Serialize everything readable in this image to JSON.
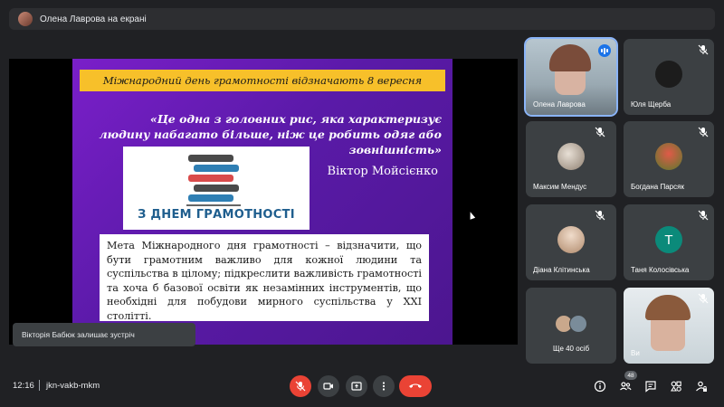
{
  "presenter": {
    "label": "Олена Лаврова на екрані"
  },
  "slide": {
    "header": "Міжнародний день грамотності відзначають  8 вересня",
    "quote": "«Це одна з головних рис, яка характеризує людину набагато більше, ніж це робить одяг  або зовнішність»",
    "author": "Віктор Мойсієнко",
    "book_caption": "З ДНЕМ ГРАМОТНОСТІ",
    "body": "Мета Міжнародного дня грамотності – відзначити, що бути грамотним важливо для кожної людини та суспільства в цілому; підкреслити важливість грамотності та хоча б базової освіти як незамінних інструментів, що необхідні для побудови мирного суспільства у XXI столітті."
  },
  "toast": "Вікторія Бабюк залишає зустріч",
  "tiles": [
    {
      "name": "Олена Лаврова",
      "avatar_color": "#d9b8a8"
    },
    {
      "name": "Юля Щерба",
      "avatar_color": "#1c1c1c"
    },
    {
      "name": "Максим Мендус",
      "avatar_color": "#c8bfb4"
    },
    {
      "name": "Богдана Парсяк",
      "avatar_color": "#c84a3a"
    },
    {
      "name": "Діана Клітинська",
      "avatar_color": "#e6d2c0"
    },
    {
      "name": "Таня Колосівська",
      "initial": "Т",
      "avatar_color": "#0b8a7a"
    },
    {
      "name": "Ще 40 осіб"
    },
    {
      "name": "Ви",
      "avatar_color": "#cdd8de"
    }
  ],
  "bottom": {
    "time": "12:16",
    "meeting_code": "jkn-vakb-mkm",
    "participants_badge": "48"
  },
  "colors": {
    "hangup": "#ea4335",
    "speaking": "#1a73e8",
    "bar": "#3c4043"
  }
}
